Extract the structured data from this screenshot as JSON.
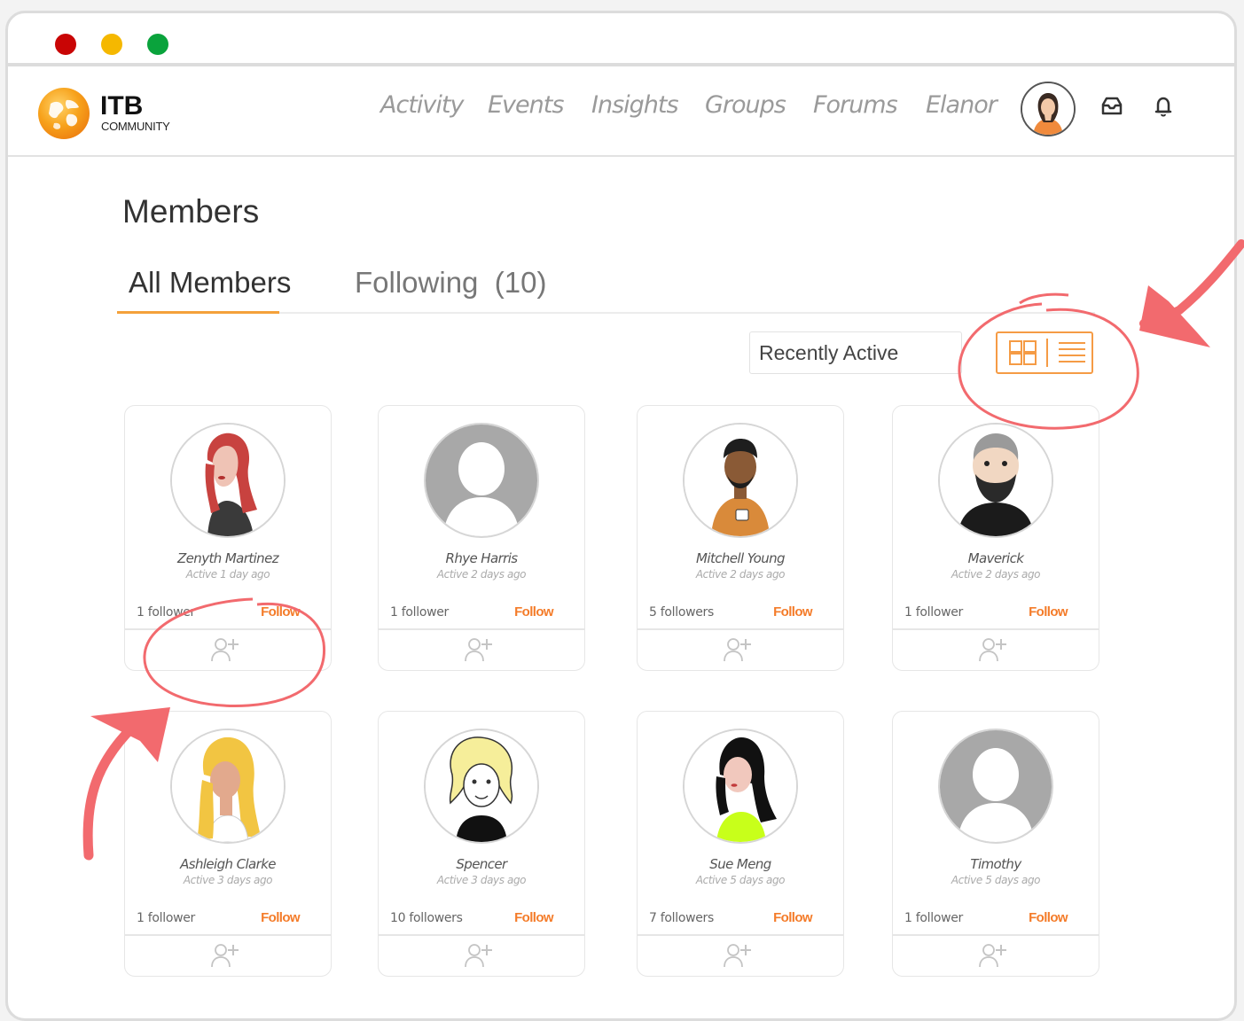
{
  "brand": {
    "title": "ITB",
    "subtitle": "COMMUNITY"
  },
  "nav": {
    "links": [
      "Activity",
      "Events",
      "Insights",
      "Groups",
      "Forums",
      "Elanor"
    ]
  },
  "icons": {
    "logo": "globe-logo-icon",
    "inbox": "inbox-icon",
    "notifications": "bell-icon",
    "grid_view": "grid-view-icon",
    "list_view": "list-view-icon",
    "add_friend": "add-friend-icon"
  },
  "colors": {
    "accent": "#f47c2a",
    "annotation": "#f26a6e"
  },
  "page": {
    "title": "Members",
    "tabs": [
      {
        "label": "All Members",
        "active": true
      },
      {
        "label": "Following",
        "count": "(10)",
        "active": false
      }
    ],
    "sort": {
      "selected": "Recently Active"
    }
  },
  "members": [
    {
      "name": "Zenyth Martinez",
      "active": "Active 1 day ago",
      "followers": "1 follower",
      "follow_label": "Follow"
    },
    {
      "name": "Rhye Harris",
      "active": "Active 2 days ago",
      "followers": "1 follower",
      "follow_label": "Follow"
    },
    {
      "name": "Mitchell Young",
      "active": "Active 2 days ago",
      "followers": "5 followers",
      "follow_label": "Follow"
    },
    {
      "name": "Maverick",
      "active": "Active 2 days ago",
      "followers": "1 follower",
      "follow_label": "Follow"
    },
    {
      "name": "Ashleigh Clarke",
      "active": "Active 3 days ago",
      "followers": "1 follower",
      "follow_label": "Follow"
    },
    {
      "name": "Spencer",
      "active": "Active 3 days ago",
      "followers": "10 followers",
      "follow_label": "Follow"
    },
    {
      "name": "Sue Meng",
      "active": "Active 5 days ago",
      "followers": "7 followers",
      "follow_label": "Follow"
    },
    {
      "name": "Timothy",
      "active": "Active 5 days ago",
      "followers": "1 follower",
      "follow_label": "Follow"
    }
  ]
}
